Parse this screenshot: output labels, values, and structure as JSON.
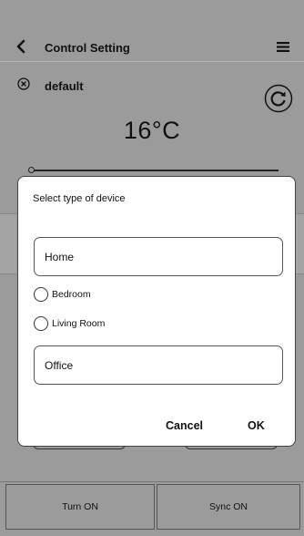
{
  "header": {
    "title": "Control Setting",
    "back_icon": "chevron-left-icon",
    "menu_icon": "hamburger-menu-icon"
  },
  "profile": {
    "name": "default",
    "close_icon": "close-circle-icon",
    "refresh_icon": "refresh-icon"
  },
  "temperature": {
    "display": "16°C"
  },
  "dialog": {
    "title": "Select type of device",
    "options": [
      {
        "label": "Home",
        "style": "box"
      },
      {
        "label": "Bedroom",
        "style": "radio",
        "selected": false
      },
      {
        "label": "Living Room",
        "style": "radio",
        "selected": false
      },
      {
        "label": "Office",
        "style": "box"
      }
    ],
    "cancel_label": "Cancel",
    "ok_label": "OK"
  },
  "bottom": {
    "turn_on_label": "Turn ON",
    "sync_on_label": "Sync ON"
  },
  "colors": {
    "overlay_background": "#9b9b9b",
    "dialog_background": "#ffffff",
    "text": "#111111"
  }
}
